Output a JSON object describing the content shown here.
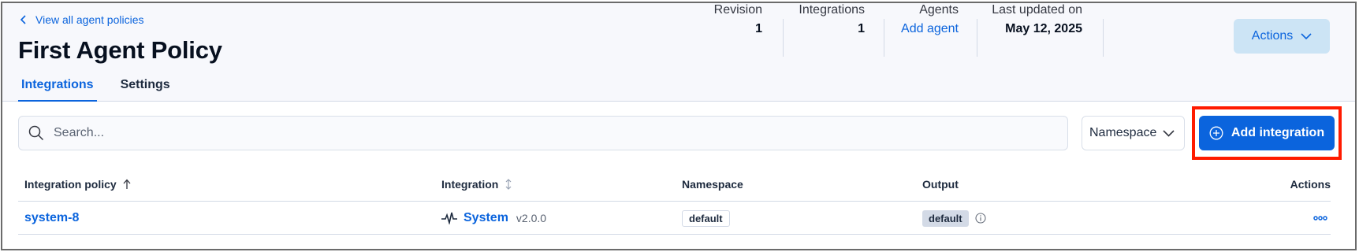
{
  "header": {
    "back_link": "View all agent policies",
    "title": "First Agent Policy",
    "tabs": [
      {
        "label": "Integrations",
        "active": true
      },
      {
        "label": "Settings",
        "active": false
      }
    ],
    "stats": {
      "revision": {
        "label": "Revision",
        "value": "1"
      },
      "integrations": {
        "label": "Integrations",
        "value": "1"
      },
      "agents": {
        "label": "Agents",
        "link": "Add agent"
      },
      "last_updated": {
        "label": "Last updated on",
        "value": "May 12, 2025"
      }
    },
    "actions_label": "Actions"
  },
  "toolbar": {
    "search_placeholder": "Search...",
    "namespace_label": "Namespace",
    "add_integration_label": "Add integration"
  },
  "table": {
    "columns": [
      "Integration policy",
      "Integration",
      "Namespace",
      "Output",
      "Actions"
    ],
    "rows": [
      {
        "policy": "system-8",
        "integration": "System",
        "version": "v2.0.0",
        "namespace": "default",
        "output": "default"
      }
    ]
  },
  "colors": {
    "accent": "#0b64dd",
    "highlight": "#ff1b00",
    "header_bg": "#f7f8fc"
  },
  "icons": [
    "chevron-left-icon",
    "chevron-down-icon",
    "search-icon",
    "plus-circle-icon",
    "sort-up-icon",
    "sort-icon",
    "pulse-icon",
    "info-icon",
    "ellipsis-icon"
  ]
}
